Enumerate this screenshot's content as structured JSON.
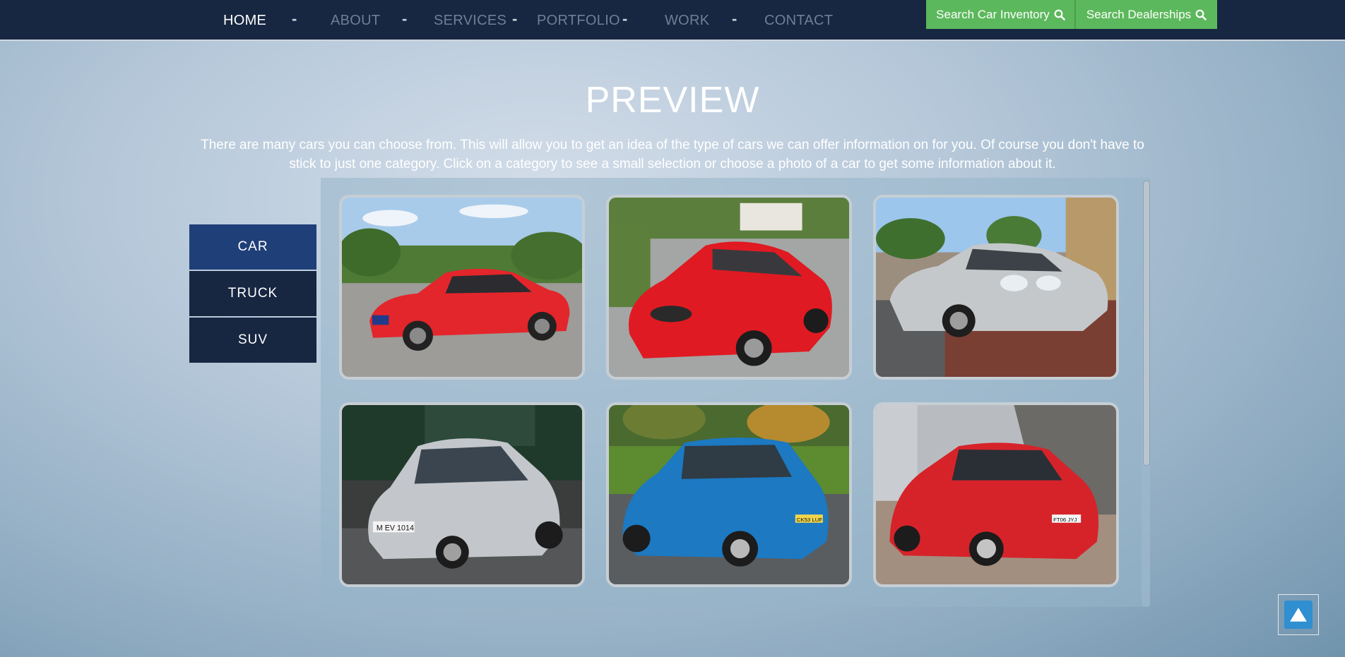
{
  "nav": {
    "items": [
      {
        "label": "HOME"
      },
      {
        "label": "ABOUT"
      },
      {
        "label": "SERVICES"
      },
      {
        "label": "PORTFOLIO"
      },
      {
        "label": "WORK"
      },
      {
        "label": "CONTACT"
      }
    ],
    "active": "HOME",
    "separator": "-",
    "search_inventory_label": "Search Car Inventory",
    "search_dealerships_label": "Search Dealerships",
    "search_icon": "search-icon"
  },
  "hero": {
    "title": "PREVIEW",
    "intro": "There are many cars you can choose from. This will allow you to get an idea of the type of cars we can offer information on for you. Of course you don't have to stick to just one category. Click on a category to see a small selection or choose a photo of a car to get some information about it."
  },
  "categories": [
    {
      "label": "CAR"
    },
    {
      "label": "TRUCK"
    },
    {
      "label": "SUV"
    }
  ],
  "active_category": "CAR",
  "gallery": {
    "photos": [
      {
        "car_color": "#e3262b"
      },
      {
        "car_color": "#e01a22"
      },
      {
        "car_color": "#bfc3c6"
      },
      {
        "car_color": "#c3c7cb",
        "plate": "M EV 1014"
      },
      {
        "car_color": "#1c79c2",
        "plate": "CK53 LUF"
      },
      {
        "car_color": "#d6232a",
        "plate": "FT06 JYJ"
      }
    ]
  },
  "back_to_top": {
    "icon": "arrow-up-icon"
  },
  "colors": {
    "navbar": "#172641",
    "search_button": "#5cb85c",
    "active_category": "#1f3f78",
    "category": "#172641",
    "back_to_top": "#2f8fd0"
  }
}
